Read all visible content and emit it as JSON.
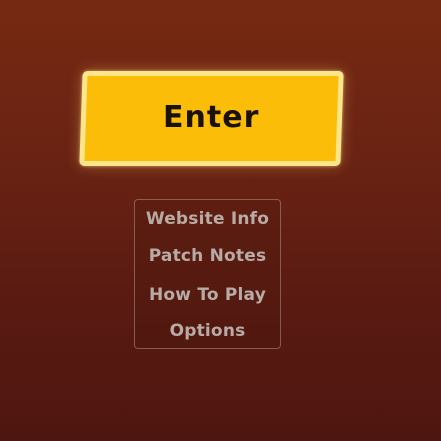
{
  "enter_button": {
    "label": "Enter"
  },
  "menu": {
    "items": [
      {
        "label": "Website Info"
      },
      {
        "label": "Patch Notes"
      },
      {
        "label": "How To Play"
      },
      {
        "label": "Options"
      }
    ]
  },
  "colors": {
    "background_top": "#762912",
    "background_bottom": "#4e1610",
    "enter_fill": "#fbbd08",
    "enter_border": "#fde58a",
    "menu_text": "#b8aba5"
  }
}
